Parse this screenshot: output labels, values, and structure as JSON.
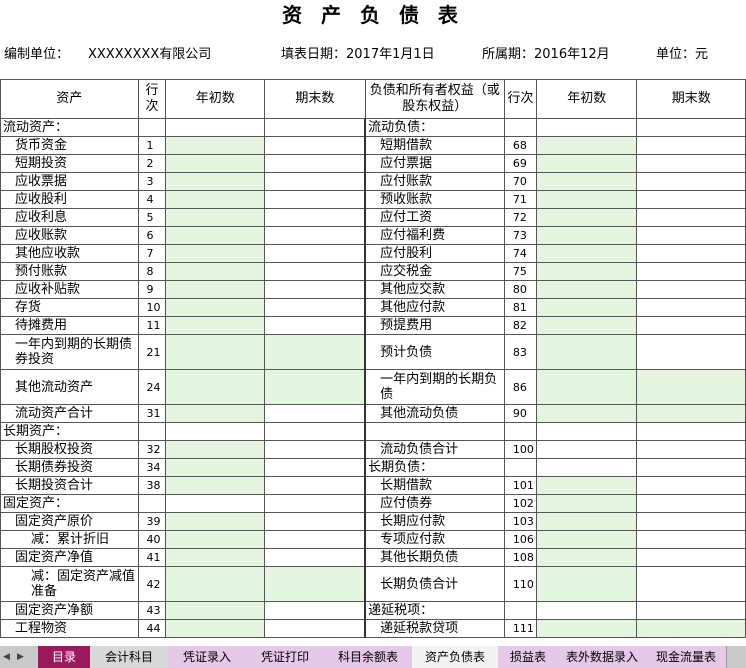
{
  "title": "资 产 负 债 表",
  "meta": {
    "unit_label": "编制单位：",
    "unit_value": "XXXXXXXX有限公司",
    "fill_date": "填表日期：2017年1月1日",
    "period": "所属期：2016年12月",
    "currency": "单位：元"
  },
  "headers": {
    "asset": "资产",
    "row_no": "行次",
    "begin": "年初数",
    "end": "期末数",
    "liab": "负债和所有者权益（或股东权益）",
    "row_no2": "行次",
    "begin2": "年初数",
    "end2": "期末数"
  },
  "rows": [
    {
      "a": "流动资产：",
      "an": "",
      "l": "流动负债：",
      "ln": ""
    },
    {
      "a": "货币资金",
      "an": "1",
      "l": "短期借款",
      "ln": "68"
    },
    {
      "a": "短期投资",
      "an": "2",
      "l": "应付票据",
      "ln": "69"
    },
    {
      "a": "应收票据",
      "an": "3",
      "l": "应付账款",
      "ln": "70"
    },
    {
      "a": "应收股利",
      "an": "4",
      "l": "预收账款",
      "ln": "71"
    },
    {
      "a": "应收利息",
      "an": "5",
      "l": "应付工资",
      "ln": "72"
    },
    {
      "a": "应收账款",
      "an": "6",
      "l": "应付福利费",
      "ln": "73"
    },
    {
      "a": "其他应收款",
      "an": "7",
      "l": "应付股利",
      "ln": "74"
    },
    {
      "a": "预付账款",
      "an": "8",
      "l": "应交税金",
      "ln": "75"
    },
    {
      "a": "应收补贴款",
      "an": "9",
      "l": "其他应交款",
      "ln": "80"
    },
    {
      "a": "存货",
      "an": "10",
      "l": "其他应付款",
      "ln": "81"
    },
    {
      "a": "待摊费用",
      "an": "11",
      "l": "预提费用",
      "ln": "82"
    },
    {
      "a": "一年内到期的长期债券投资",
      "an": "21",
      "l": "预计负债",
      "ln": "83"
    },
    {
      "a": "其他流动资产",
      "an": "24",
      "l": "一年内到期的长期负债",
      "ln": "86"
    },
    {
      "a": "流动资产合计",
      "an": "31",
      "l": "其他流动负债",
      "ln": "90"
    },
    {
      "a": "长期资产：",
      "an": "",
      "l": "",
      "ln": ""
    },
    {
      "a": "长期股权投资",
      "an": "32",
      "l": "流动负债合计",
      "ln": "100"
    },
    {
      "a": "长期债券投资",
      "an": "34",
      "l": "长期负债：",
      "ln": ""
    },
    {
      "a": "长期投资合计",
      "an": "38",
      "l": "长期借款",
      "ln": "101"
    },
    {
      "a": "固定资产：",
      "an": "",
      "l": "应付债券",
      "ln": "102"
    },
    {
      "a": "固定资产原价",
      "an": "39",
      "l": "长期应付款",
      "ln": "103"
    },
    {
      "a": "减：累计折旧",
      "an": "40",
      "l": "专项应付款",
      "ln": "106"
    },
    {
      "a": "固定资产净值",
      "an": "41",
      "l": "其他长期负债",
      "ln": "108"
    },
    {
      "a": "减：固定资产减值准备",
      "an": "42",
      "l": "长期负债合计",
      "ln": "110"
    },
    {
      "a": "固定资产净额",
      "an": "43",
      "l": "递延税项：",
      "ln": ""
    },
    {
      "a": "工程物资",
      "an": "44",
      "l": "递延税款贷项",
      "ln": "111"
    }
  ],
  "tabs": [
    "目录",
    "会计科目",
    "凭证录入",
    "凭证打印",
    "科目余额表",
    "资产负债表",
    "损益表",
    "表外数据录入",
    "现金流量表"
  ],
  "tab_colors": {
    "目录": "#9b1a5e",
    "会计科目": "#d8d8d8",
    "凭证录入": "#e6c8e8",
    "凭证打印": "#e6c8e8",
    "科目余额表": "#e6c8e8",
    "资产负债表": "#f3f3f3",
    "损益表": "#e6c8e8",
    "表外数据录入": "#e6c8e8",
    "现金流量表": "#e6c8e8"
  }
}
